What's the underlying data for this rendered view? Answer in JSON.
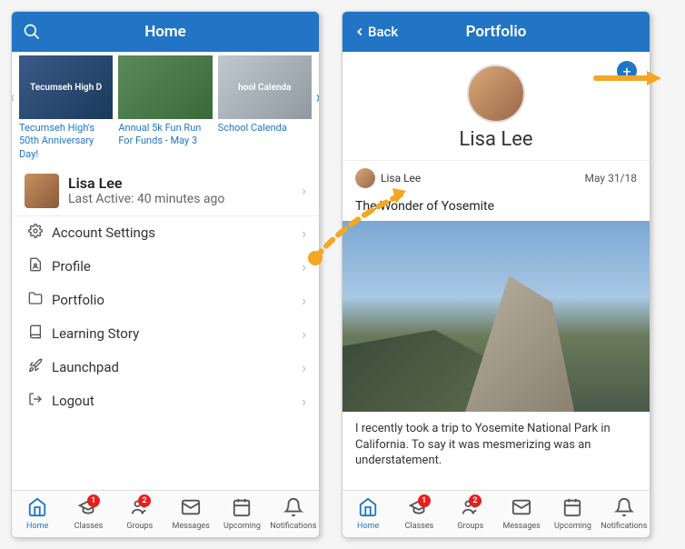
{
  "colors": {
    "brand": "#2175c4",
    "badge": "#e62020",
    "annot": "#f5a623"
  },
  "screen1": {
    "header": {
      "title": "Home",
      "search_icon": "search-icon"
    },
    "cards": [
      {
        "img_text": "Tecumseh High D",
        "caption": "Tecumseh High's 50th Anniversary Day!"
      },
      {
        "img_text": "",
        "caption": "Annual 5k Fun Run For Funds - May 3"
      },
      {
        "img_text": "hool Calenda",
        "caption": "School Calenda"
      }
    ],
    "profile": {
      "name": "Lisa Lee",
      "subtitle": "Last Active: 40 minutes ago"
    },
    "menu": [
      {
        "icon": "gear-icon",
        "label": "Account Settings"
      },
      {
        "icon": "profile-doc-icon",
        "label": "Profile"
      },
      {
        "icon": "folder-icon",
        "label": "Portfolio"
      },
      {
        "icon": "book-icon",
        "label": "Learning Story"
      },
      {
        "icon": "rocket-icon",
        "label": "Launchpad"
      },
      {
        "icon": "logout-icon",
        "label": "Logout"
      }
    ]
  },
  "screen2": {
    "header": {
      "back_label": "Back",
      "title": "Portfolio"
    },
    "add_icon": "plus-icon",
    "user": {
      "name": "Lisa Lee"
    },
    "post": {
      "author": "Lisa Lee",
      "date": "May 31/18",
      "title": "The Wonder of Yosemite",
      "body": "I recently took a trip to Yosemite National Park in California. To say it was mesmerizing was an understatement."
    }
  },
  "tabs": [
    {
      "label": "Home",
      "icon": "home-icon",
      "badge": null,
      "active": true
    },
    {
      "label": "Classes",
      "icon": "classes-icon",
      "badge": "1",
      "active": false
    },
    {
      "label": "Groups",
      "icon": "groups-icon",
      "badge": "2",
      "active": false
    },
    {
      "label": "Messages",
      "icon": "messages-icon",
      "badge": null,
      "active": false
    },
    {
      "label": "Upcoming",
      "icon": "upcoming-icon",
      "badge": null,
      "active": false
    },
    {
      "label": "Notifications",
      "icon": "notifications-icon",
      "badge": null,
      "active": false
    }
  ]
}
